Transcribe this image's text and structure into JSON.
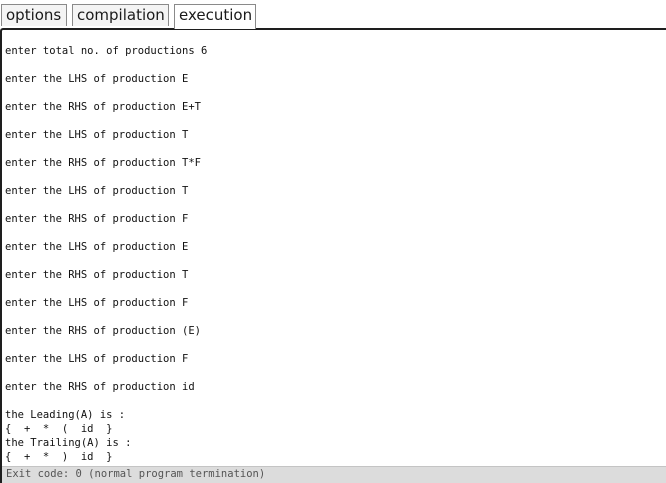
{
  "tabs": {
    "options": "options",
    "compilation": "compilation",
    "execution": "execution",
    "active": "execution"
  },
  "output": {
    "lines": [
      "enter total no. of productions 6",
      "enter the LHS of production E",
      "enter the RHS of production E+T",
      "enter the LHS of production T",
      "enter the RHS of production T*F",
      "enter the LHS of production T",
      "enter the RHS of production F",
      "enter the LHS of production E",
      "enter the RHS of production T",
      "enter the LHS of production F",
      "enter the RHS of production (E)",
      "enter the LHS of production F",
      "enter the RHS of production id"
    ],
    "result_lines": [
      "the Leading(A) is :",
      "{  +  *  (  id  }",
      "the Trailing(A) is :",
      "{  +  *  )  id  }"
    ]
  },
  "status": {
    "text": "Exit code: 0 (normal program termination)"
  }
}
